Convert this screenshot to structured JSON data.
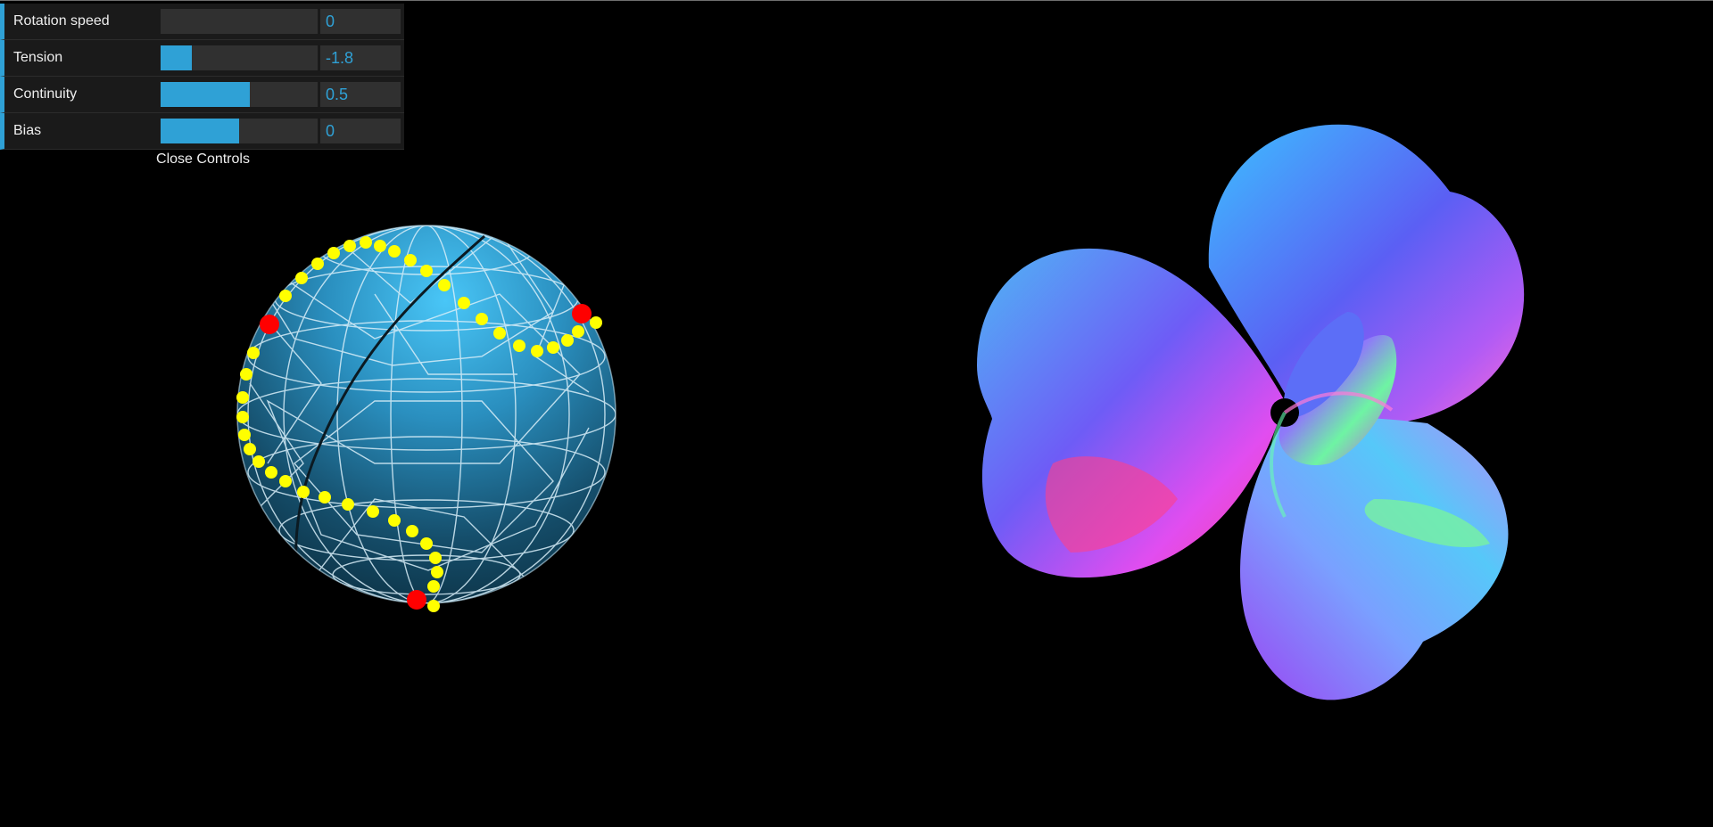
{
  "controls": [
    {
      "label": "Rotation speed",
      "value": "0",
      "level": 0.0
    },
    {
      "label": "Tension",
      "value": "-1.8",
      "level": 0.2
    },
    {
      "label": "Continuity",
      "value": "0.5",
      "level": 0.57
    },
    {
      "label": "Bias",
      "value": "0",
      "level": 0.5
    }
  ],
  "close_label": "Close Controls",
  "colors": {
    "accent": "#2fa1d6",
    "panel_bg": "#1a1a1a",
    "slider_track": "#303030",
    "background": "#000000",
    "spline_points": "#ffff00",
    "control_points": "#ff0000",
    "sphere": "#2aa6e0"
  },
  "scene": {
    "left_object": "wireframe-sphere",
    "right_object": "normal-shaded-knot"
  }
}
